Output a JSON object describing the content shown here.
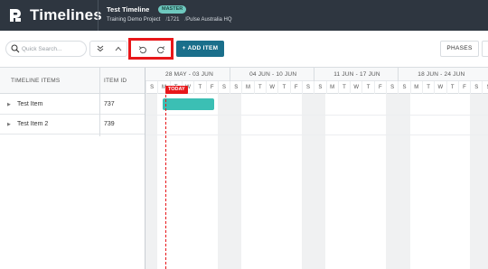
{
  "app": {
    "title": "Timelines"
  },
  "timeline": {
    "name": "Test Timeline",
    "badge": "MASTER",
    "project": "Training Demo Project",
    "project_number": "1721",
    "site": "Pulse Australia HQ",
    "separator": "/"
  },
  "toolbar": {
    "search_placeholder": "Quick Search...",
    "add_item_label": "+ ADD ITEM",
    "phases_label": "PHASES"
  },
  "grid": {
    "col_items_header": "TIMELINE ITEMS",
    "col_id_header": "ITEM ID",
    "weeks": [
      "28 MAY - 03 JUN",
      "04 JUN - 10 JUN",
      "11 JUN - 17 JUN",
      "18 JUN - 24 JUN"
    ],
    "day_letters": [
      "S",
      "M",
      "T",
      "W",
      "T",
      "F",
      "S"
    ],
    "today_label": "TODAY",
    "rows": [
      {
        "name": "Test Item",
        "id": "737"
      },
      {
        "name": "Test Item 2",
        "id": "739"
      }
    ]
  },
  "colors": {
    "header_bg": "#2e3640",
    "accent": "#1a6f8b",
    "task_bar": "#3bbfb4",
    "today": "#e8171a",
    "badge": "#6ec9bf"
  },
  "icons": {
    "logo": "pulse-logo-icon",
    "search": "search-icon",
    "expand": "expand-all-icon",
    "collapse": "collapse-all-icon",
    "undo": "undo-icon",
    "redo": "redo-icon",
    "row_caret": "caret-right-icon"
  }
}
